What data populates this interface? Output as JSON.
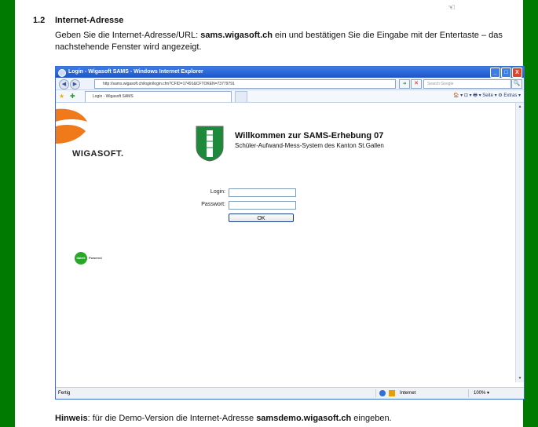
{
  "section": {
    "number": "1.2",
    "title": "Internet-Adresse",
    "cursor_glyph": "☜",
    "intro_before": "Geben Sie die Internet-Adresse/URL: ",
    "intro_url": "sams.wigasoft.ch",
    "intro_after": " ein und bestätigen Sie die Eingabe mit der Entertaste – das nachstehende Fenster wird angezeigt."
  },
  "browser": {
    "title": "Login - Wigasoft SAMS - Windows Internet Explorer",
    "url": "http://sams.wigasoft.ch/login/login.cfm?CFID=17491&CFTOKEN=73779791",
    "search_placeholder": "Search Google",
    "tab_label": "Login - Wigasoft SAMS",
    "tools": "🏠 ▾  ⊡ ▾  🖶 ▾  Seite ▾  ⚙ Extras ▾",
    "status_text": "Fertig",
    "zone_text": "Internet",
    "zoom_text": "100%  ▾",
    "controls": {
      "minimize": "_",
      "maximize": "□",
      "close": "X",
      "back": "◀",
      "forward": "▶",
      "go": "➜",
      "stop": "✕",
      "search": "🔍",
      "scroll_up": "▲",
      "scroll_down": "▼"
    }
  },
  "page": {
    "brand": "WIGASOFT.",
    "welcome": "Willkommen zur SAMS-Erhebung 07",
    "subtitle": "Schüler-Aufwand-Mess-System des Kanton St.Gallen",
    "login_label": "Login:",
    "password_label": "Passwort:",
    "ok_label": "OK",
    "badge": "italert",
    "powered": "Powered"
  },
  "hint": {
    "prefix": "Hinweis",
    "middle": ": für die Demo-Version die Internet-Adresse ",
    "url": "samsdemo.wigasoft.ch",
    "suffix": " eingeben."
  },
  "colors": {
    "frame_green": "#007a00",
    "ie_title_blue": "#1d55c8",
    "logo_orange": "#f07a1a",
    "crest_green": "#1c8a3a"
  }
}
